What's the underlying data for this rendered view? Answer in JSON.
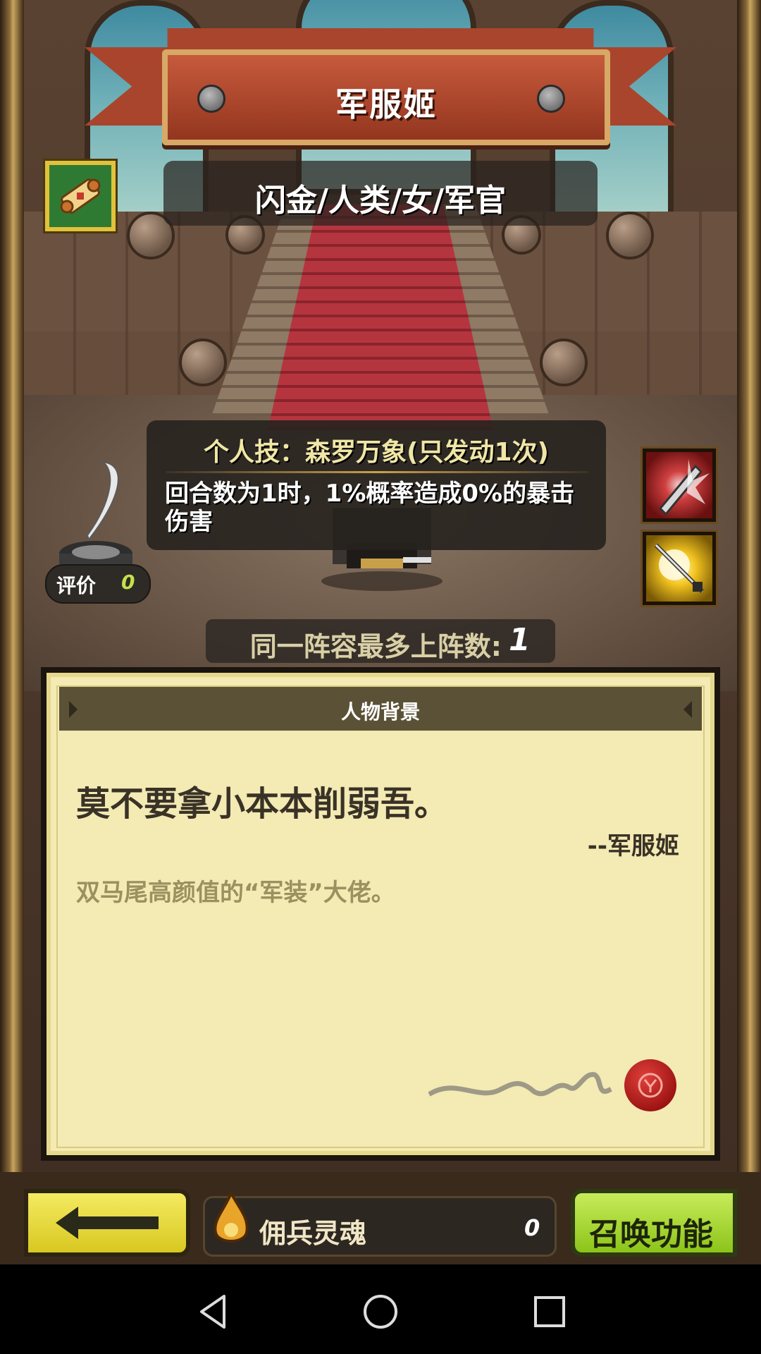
{
  "hero": {
    "name": "军服姬",
    "classification": "闪金/人类/女/军官"
  },
  "skill": {
    "title": "个人技：森罗万象(只发动1次)",
    "description": "回合数为1时，1%概率造成0%的暴击伤害"
  },
  "rating": {
    "label": "评价",
    "value": "0"
  },
  "deploy_limit": {
    "label": "同一阵容最多上阵数:",
    "value": "1"
  },
  "background": {
    "header": "人物背景",
    "quote": "莫不要拿小本本削弱吾。",
    "author": "--军服姬",
    "description": "双马尾高颜值的“军装”大佬。"
  },
  "footer": {
    "soul_label": "佣兵灵魂",
    "soul_value": "0",
    "summon_label": "召唤功能"
  },
  "icons": {
    "scroll": "scroll-icon",
    "skill_1": "sword-slash-icon",
    "skill_2": "sword-glow-icon",
    "back": "arrow-left-icon",
    "soul": "soul-flame-icon"
  }
}
